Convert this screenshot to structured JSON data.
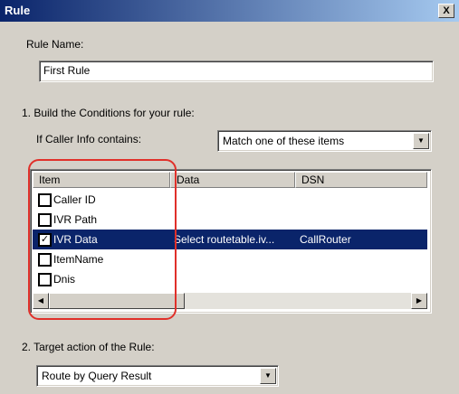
{
  "window": {
    "title": "Rule",
    "close_glyph": "X"
  },
  "rule_name": {
    "label": "Rule Name:",
    "value": "First Rule"
  },
  "conditions": {
    "heading": "1. Build the Conditions for your rule:",
    "caller_info_label": "If Caller Info contains:",
    "match_select": {
      "value": "Match one of these items"
    },
    "table": {
      "columns": [
        "Item",
        "Data",
        "DSN"
      ],
      "rows": [
        {
          "item": "Caller ID",
          "checked": false,
          "data": "",
          "dsn": ""
        },
        {
          "item": "IVR Path",
          "checked": false,
          "data": "",
          "dsn": ""
        },
        {
          "item": "IVR Data",
          "checked": true,
          "data": "Select routetable.iv...",
          "dsn": "CallRouter",
          "selected": true
        },
        {
          "item": "ItemName",
          "checked": false,
          "data": "",
          "dsn": ""
        },
        {
          "item": "Dnis",
          "checked": false,
          "data": "",
          "dsn": ""
        }
      ],
      "highlight_color": "#e0302a"
    }
  },
  "target": {
    "heading": "2. Target action of the Rule:",
    "select": {
      "value": "Route by Query Result"
    }
  },
  "icons": {
    "dropdown": "chevron-down-icon",
    "scroll_left": "arrow-left-icon",
    "scroll_right": "arrow-right-icon",
    "checkbox_mark": "check-icon"
  },
  "colors": {
    "selection": "#0a246a",
    "titlebar_start": "#0a246a",
    "titlebar_end": "#a6caf0"
  }
}
